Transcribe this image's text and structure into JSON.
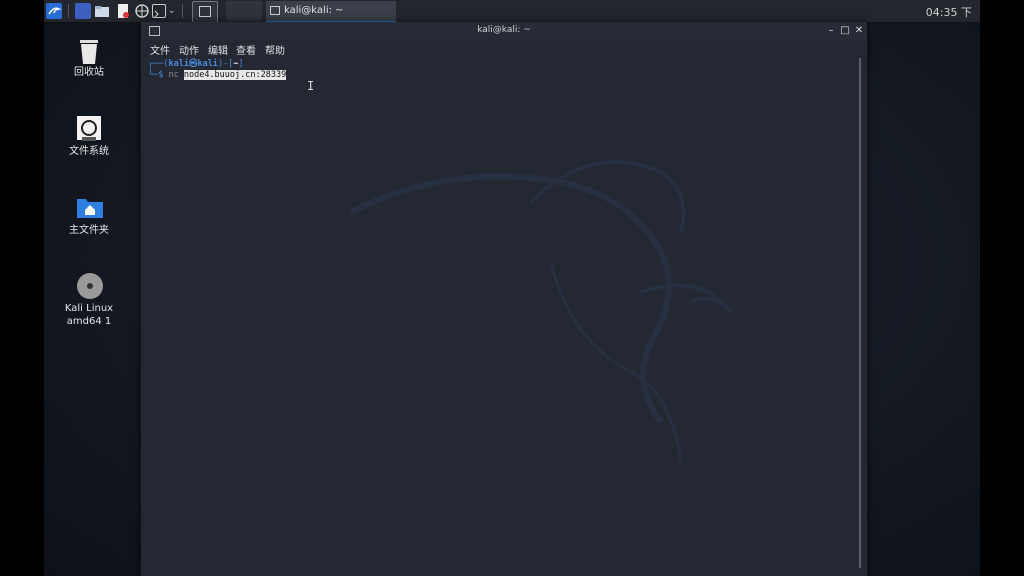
{
  "taskbar": {
    "clock": "04:35 下",
    "window_task_title": "kali@kali: ~"
  },
  "desktop_icons": [
    {
      "label": "回收站"
    },
    {
      "label": "文件系统"
    },
    {
      "label": "主文件夹"
    },
    {
      "label": "Kali Linux amd64 1"
    }
  ],
  "terminal": {
    "title": "kali@kali: ~",
    "menu": [
      "文件",
      "动作",
      "编辑",
      "查看",
      "帮助"
    ],
    "prompt_line": {
      "prefix": "┌──(",
      "userhost": "kali㉿kali",
      "mid": ")-[",
      "dir": "~",
      "suffix": "]"
    },
    "command_line": {
      "prefix": "└─$ ",
      "cmd": "nc ",
      "arg": "node4.buuoj.cn:28339"
    }
  },
  "colors": {
    "accent": "#2f6fcc",
    "terminal_bg": "#232833",
    "prompt_blue": "#4a8bdc"
  }
}
